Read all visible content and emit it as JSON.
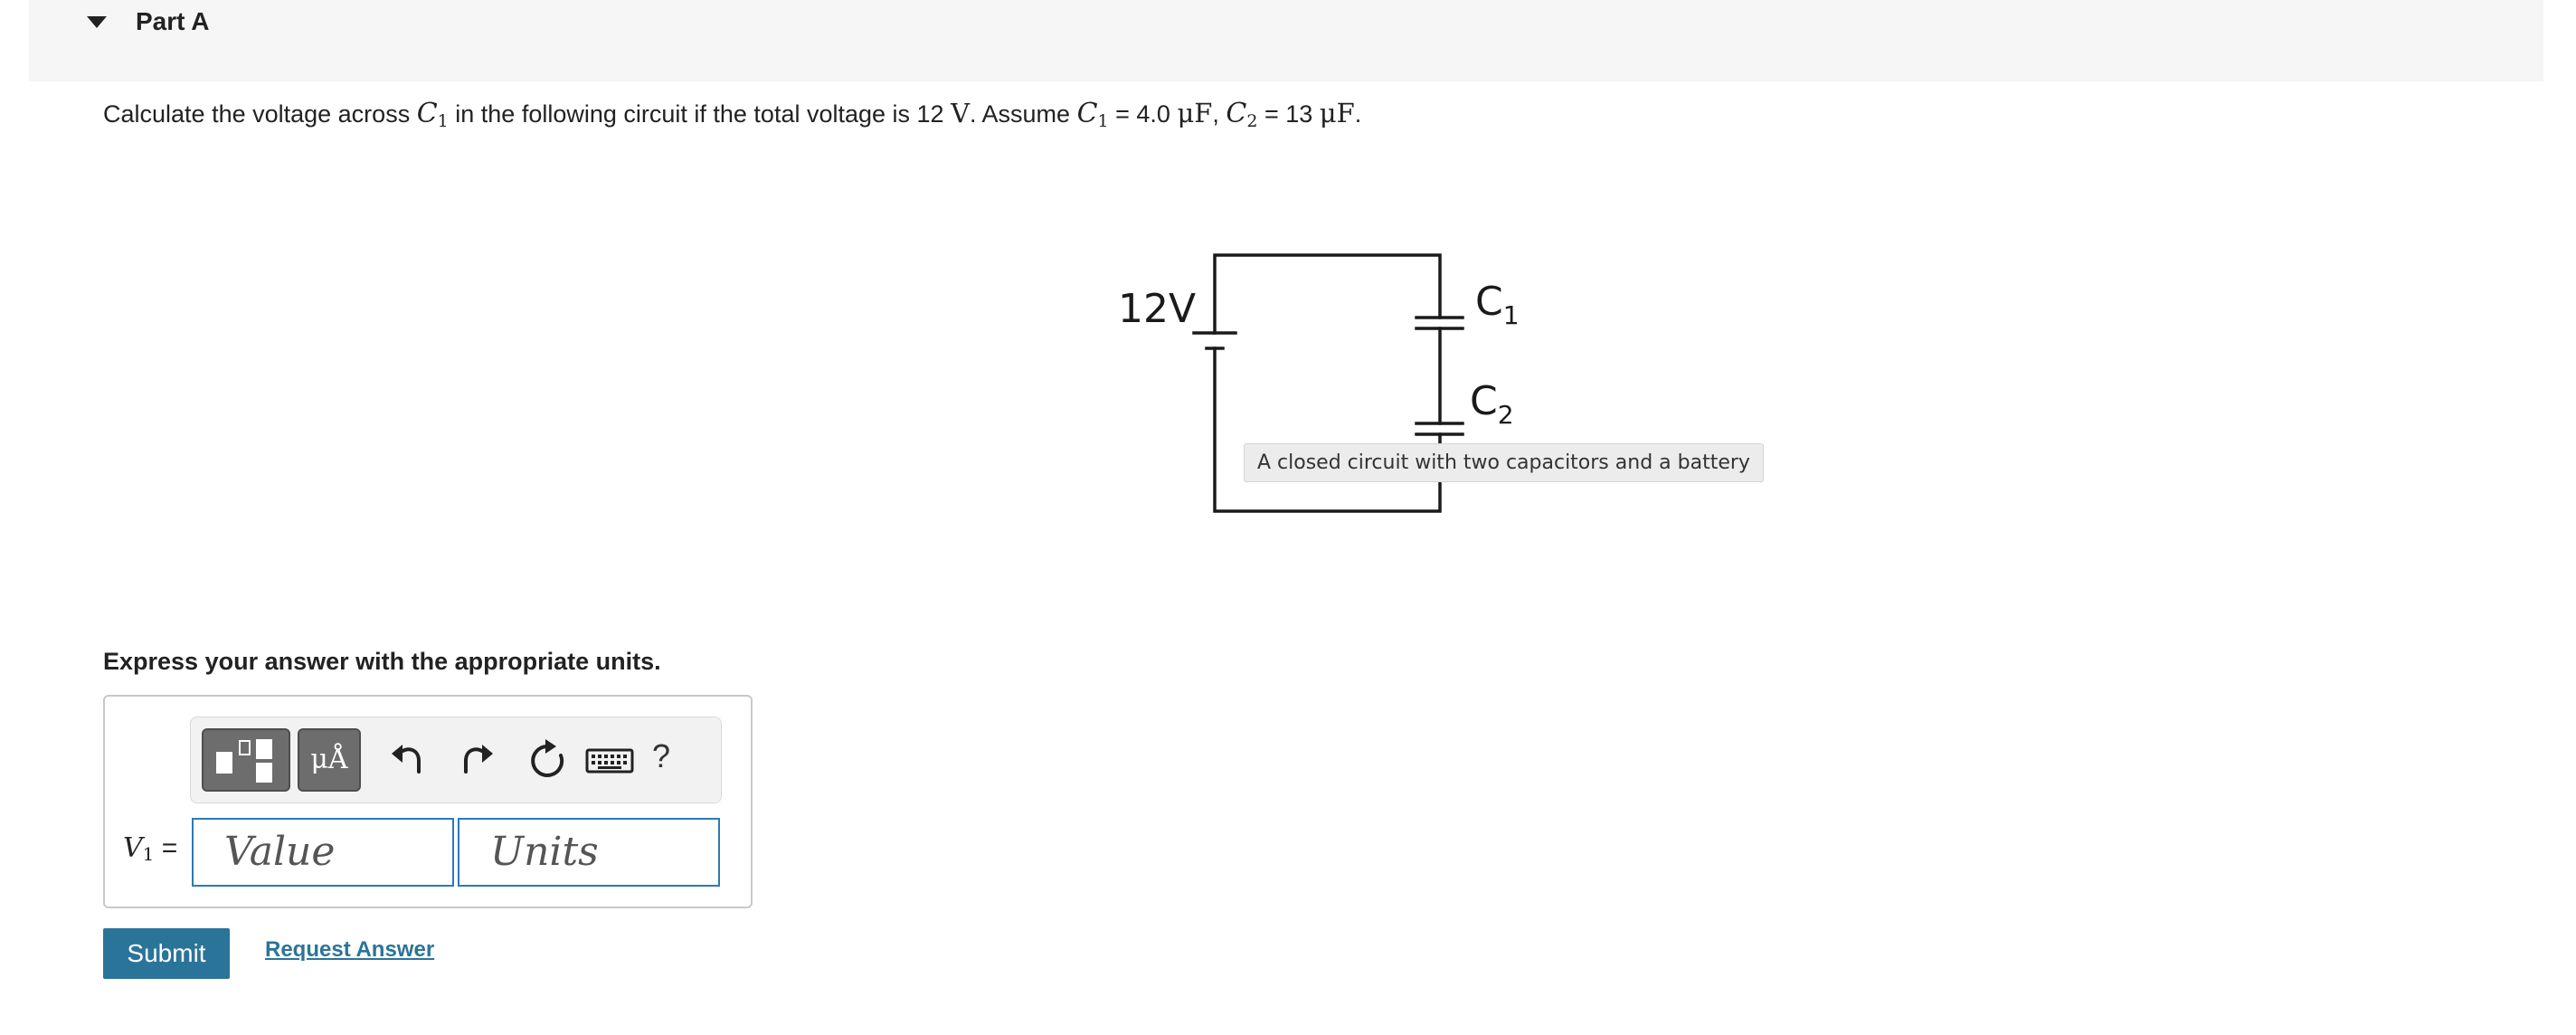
{
  "part": {
    "title": "Part A"
  },
  "question": {
    "prefix": "Calculate the voltage across ",
    "c1_symbol": "C",
    "c1_sub": "1",
    "middle": " in the following circuit if the total voltage is 12 ",
    "volt_unit": "V",
    "assume": ". Assume ",
    "c1_eq": " = 4.0 ",
    "uf_unit": "μF",
    "comma": ", ",
    "c2_symbol": "C",
    "c2_sub": "2",
    "c2_eq": " = 13 ",
    "period": "."
  },
  "figure": {
    "battery_label": "12V",
    "c1_label": "C",
    "c1_sub": "1",
    "c2_label": "C",
    "c2_sub": "2",
    "tooltip": "A closed circuit with two capacitors and a battery"
  },
  "instructions": "Express your answer with the appropriate units.",
  "answer": {
    "var_symbol": "V",
    "var_sub": "1",
    "equals": " =",
    "value_placeholder": "Value",
    "units_placeholder": "Units",
    "toolbar": {
      "templates_icon": "templates-icon",
      "units_label": "μÅ",
      "undo_icon": "undo-icon",
      "redo_icon": "redo-icon",
      "reset_icon": "reset-icon",
      "keyboard_icon": "keyboard-icon",
      "help_label": "?"
    }
  },
  "buttons": {
    "submit": "Submit",
    "request_answer": "Request Answer"
  },
  "colors": {
    "primary": "#2b7499",
    "input_border": "#2b7bb3",
    "toolbar_button": "#6d6d6d"
  }
}
